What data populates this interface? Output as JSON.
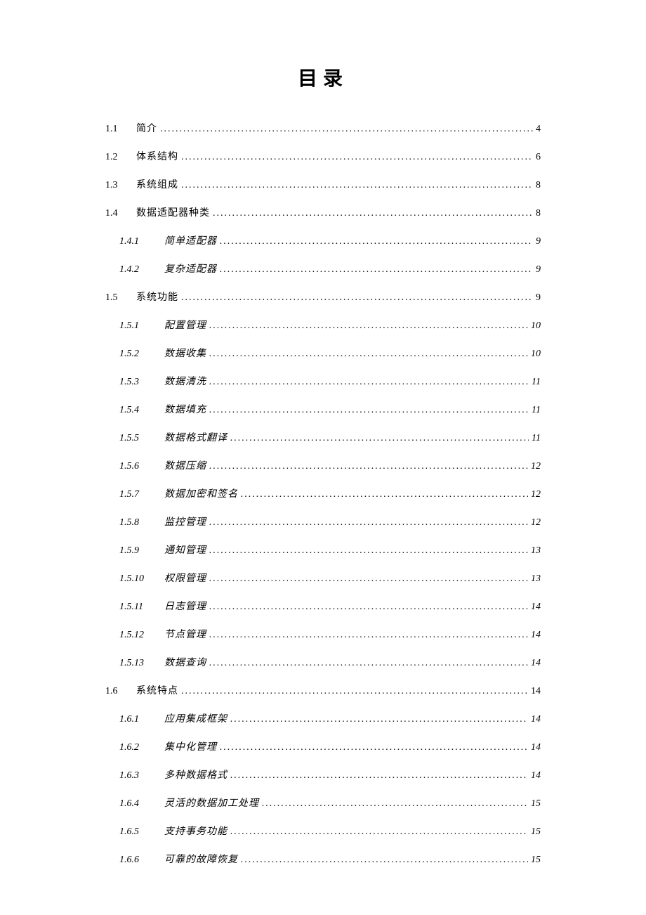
{
  "title": "目录",
  "entries": [
    {
      "level": 1,
      "num": "1.1",
      "label": "简介",
      "page": "4"
    },
    {
      "level": 1,
      "num": "1.2",
      "label": "体系结构",
      "page": "6"
    },
    {
      "level": 1,
      "num": "1.3",
      "label": "系统组成",
      "page": "8"
    },
    {
      "level": 1,
      "num": "1.4",
      "label": "数据适配器种类",
      "page": "8"
    },
    {
      "level": 2,
      "num": "1.4.1",
      "label": "简单适配器",
      "page": "9"
    },
    {
      "level": 2,
      "num": "1.4.2",
      "label": "复杂适配器",
      "page": "9"
    },
    {
      "level": 1,
      "num": "1.5",
      "label": "系统功能",
      "page": "9"
    },
    {
      "level": 2,
      "num": "1.5.1",
      "label": "配置管理",
      "page": "10"
    },
    {
      "level": 2,
      "num": "1.5.2",
      "label": "数据收集",
      "page": "10"
    },
    {
      "level": 2,
      "num": "1.5.3",
      "label": "数据清洗",
      "page": "11"
    },
    {
      "level": 2,
      "num": "1.5.4",
      "label": "数据填充",
      "page": "11"
    },
    {
      "level": 2,
      "num": "1.5.5",
      "label": "数据格式翻译",
      "page": "11"
    },
    {
      "level": 2,
      "num": "1.5.6",
      "label": "数据压缩",
      "page": "12"
    },
    {
      "level": 2,
      "num": "1.5.7",
      "label": "数据加密和签名",
      "page": "12"
    },
    {
      "level": 2,
      "num": "1.5.8",
      "label": "监控管理",
      "page": "12"
    },
    {
      "level": 2,
      "num": "1.5.9",
      "label": "通知管理",
      "page": "13"
    },
    {
      "level": 2,
      "num": "1.5.10",
      "label": "权限管理",
      "page": "13"
    },
    {
      "level": 2,
      "num": "1.5.11",
      "label": "日志管理",
      "page": "14"
    },
    {
      "level": 2,
      "num": "1.5.12",
      "label": "节点管理",
      "page": "14"
    },
    {
      "level": 2,
      "num": "1.5.13",
      "label": "数据查询",
      "page": "14"
    },
    {
      "level": 1,
      "num": "1.6",
      "label": "系统特点",
      "page": "14"
    },
    {
      "level": 2,
      "num": "1.6.1",
      "label": "应用集成框架",
      "page": "14"
    },
    {
      "level": 2,
      "num": "1.6.2",
      "label": "集中化管理",
      "page": "14"
    },
    {
      "level": 2,
      "num": "1.6.3",
      "label": "多种数据格式",
      "page": "14"
    },
    {
      "level": 2,
      "num": "1.6.4",
      "label": "灵活的数据加工处理",
      "page": "15"
    },
    {
      "level": 2,
      "num": "1.6.5",
      "label": "支持事务功能",
      "page": "15"
    },
    {
      "level": 2,
      "num": "1.6.6",
      "label": "可靠的故障恢复",
      "page": "15"
    }
  ]
}
